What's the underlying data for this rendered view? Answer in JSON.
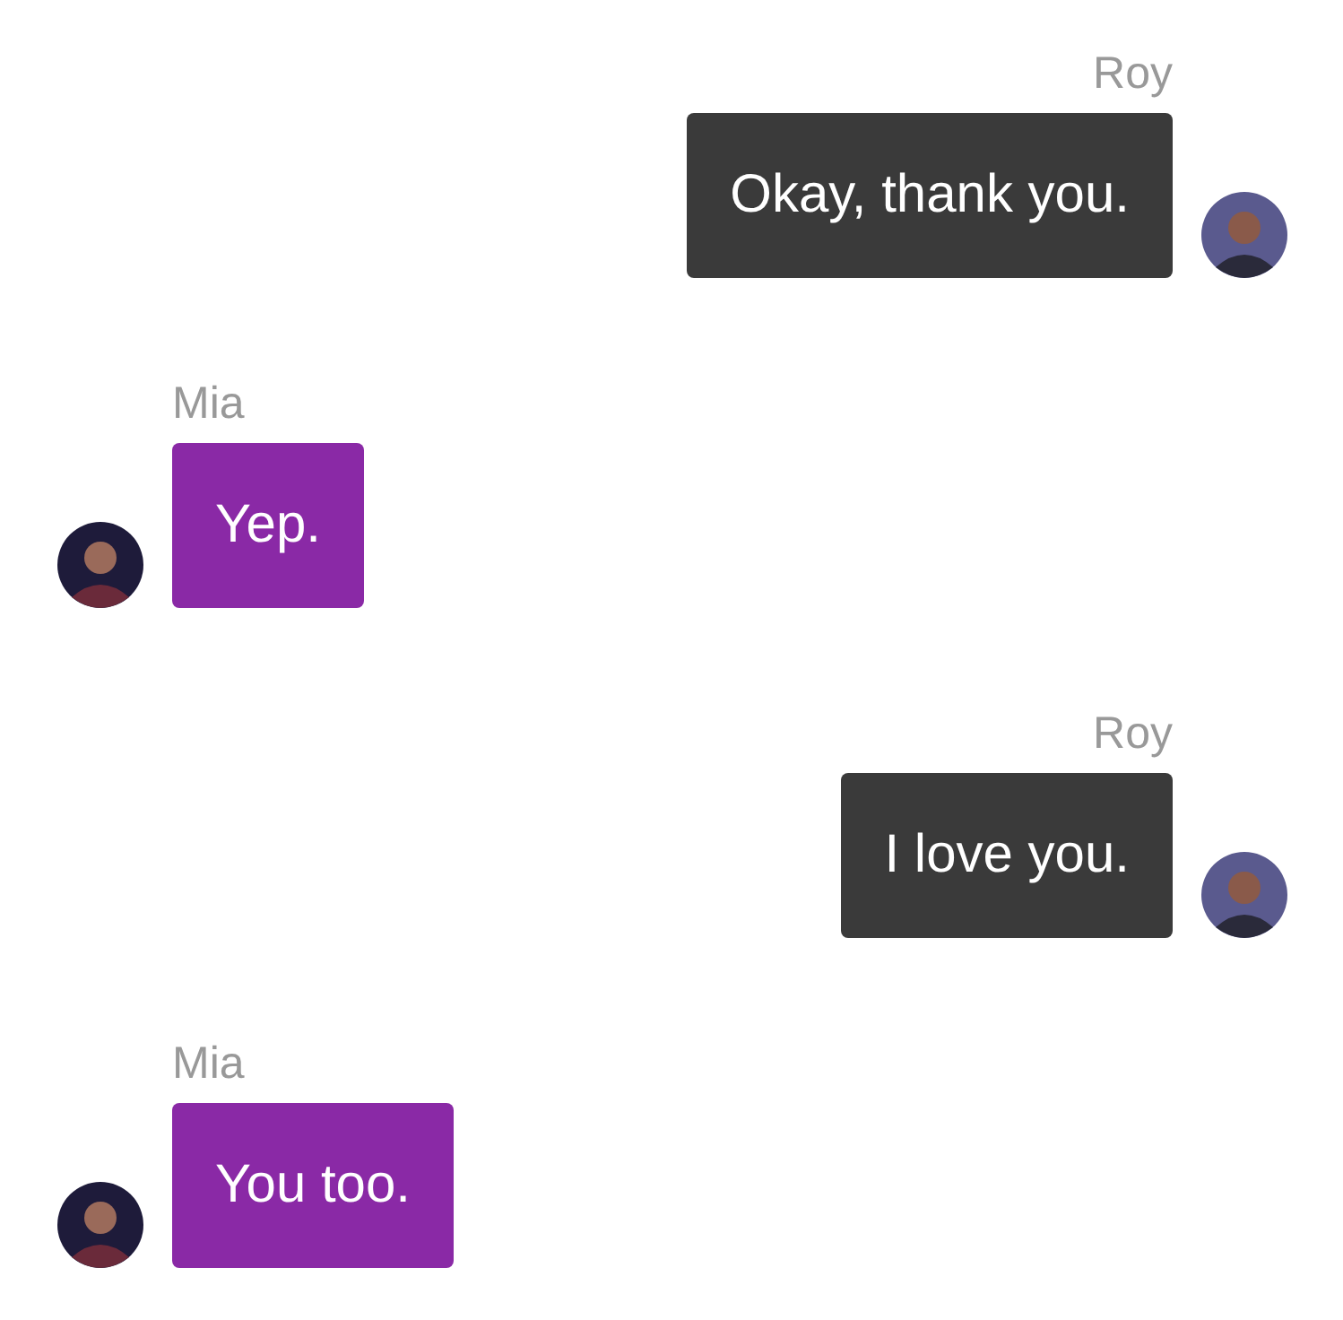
{
  "messages": [
    {
      "kind": "outgoing",
      "sender": "Roy",
      "text": "Okay, thank you."
    },
    {
      "kind": "incoming",
      "sender": "Mia",
      "text": "Yep."
    },
    {
      "kind": "outgoing",
      "sender": "Roy",
      "text": "I love you."
    },
    {
      "kind": "incoming",
      "sender": "Mia",
      "text": "You too."
    }
  ]
}
